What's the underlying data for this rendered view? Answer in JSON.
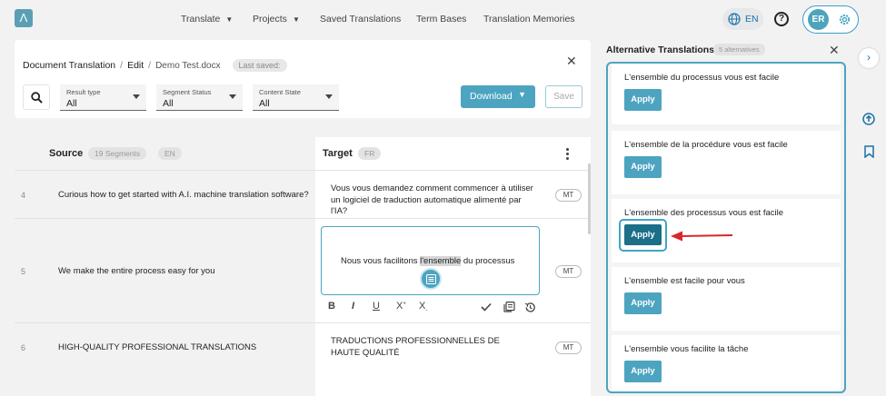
{
  "nav": {
    "logo_letter": "Λ",
    "items": [
      {
        "label": "Translate",
        "dropdown": true
      },
      {
        "label": "Projects",
        "dropdown": true
      },
      {
        "label": "Saved Translations",
        "dropdown": false
      },
      {
        "label": "Term Bases",
        "dropdown": false
      },
      {
        "label": "Translation Memories",
        "dropdown": false
      }
    ],
    "language": "EN",
    "user_initials": "ER"
  },
  "editor": {
    "breadcrumb": {
      "root": "Document Translation",
      "sep": "/",
      "action": "Edit",
      "document": "Demo Test.docx"
    },
    "last_saved": "Last saved:",
    "filters": [
      {
        "label": "Result type",
        "value": "All"
      },
      {
        "label": "Segment Status",
        "value": "All"
      },
      {
        "label": "Content State",
        "value": "All"
      }
    ],
    "download_label": "Download",
    "save_label": "Save"
  },
  "table": {
    "source_title": "Source",
    "segments_badge": "19 Segments",
    "source_lang": "EN",
    "target_title": "Target",
    "target_lang": "FR",
    "rows": [
      {
        "num": "4",
        "source": "Curious how to get started with A.I. machine translation software?",
        "target": "Vous vous demandez comment commencer à utiliser un logiciel de traduction automatique alimenté par l'IA?",
        "badge": "MT"
      },
      {
        "num": "5",
        "source": "We make the entire process easy for you",
        "target_before": "Nous vous facilitons ",
        "target_highlight": "l'ensemble",
        "target_after": " du processus",
        "badge": "MT"
      },
      {
        "num": "6",
        "source": "HIGH-QUALITY PROFESSIONAL TRANSLATIONS",
        "target": "TRADUCTIONS PROFESSIONNELLES DE HAUTE QUALITÉ",
        "badge": "MT"
      }
    ],
    "format_tools": {
      "bold": "B",
      "italic": "I",
      "underline": "U",
      "superscript": "X",
      "subscript": "X"
    }
  },
  "alternatives": {
    "title": "Alternative Translations",
    "count_badge": "5 alternatives",
    "apply_label": "Apply",
    "items": [
      {
        "text": "L'ensemble du processus vous est facile"
      },
      {
        "text": "L'ensemble de la procédure vous est facile"
      },
      {
        "text": "L'ensemble des processus vous est facile"
      },
      {
        "text": "L'ensemble est facile pour vous"
      },
      {
        "text": "L'ensemble vous facilite la tâche"
      }
    ],
    "highlighted_index": 2
  },
  "colors": {
    "accent": "#4da4c0",
    "accent_dark": "#1b6f88",
    "arrow": "#d9262b",
    "link": "#1a73a8"
  },
  "icons": {
    "search": "search-icon",
    "globe": "globe-icon",
    "help": "help-icon",
    "settings": "gear-icon",
    "close": "close-icon",
    "collapse": "chevron-right-icon",
    "upload": "upload-icon",
    "bookmark": "bookmark-icon"
  }
}
